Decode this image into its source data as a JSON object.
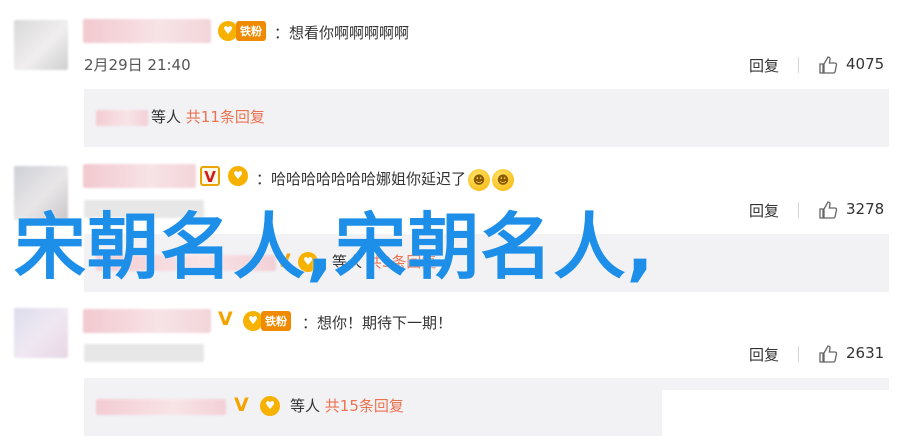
{
  "comments": [
    {
      "text": "：想看你啊啊啊啊啊",
      "badge": "铁粉",
      "time": "2月29日 21:40",
      "reply": "回复",
      "likes": "4075",
      "sub_prefix": "等人",
      "sub_count": "共11条回复"
    },
    {
      "text": "：哈哈哈哈哈哈哈娜姐你延迟了",
      "badge": "",
      "reply": "回复",
      "likes": "3278",
      "sub_prefix": "等人",
      "sub_count": "共3条回复"
    },
    {
      "text": "：想你！期待下一期！",
      "badge": "铁粉",
      "reply": "回复",
      "likes": "2631",
      "sub_prefix": "等人",
      "sub_count": "共15条回复"
    }
  ],
  "watermark": "宋朝名人,宋朝名人,",
  "icons": {
    "badge": "fan-badge-icon",
    "like": "thumbs-up-icon",
    "vip": "vip-v-icon",
    "emoji": "grin-emoji-icon"
  },
  "colors": {
    "accent": "#eb7350",
    "watermark": "#1e8fe8",
    "sub_background": "#f2f2f5"
  }
}
